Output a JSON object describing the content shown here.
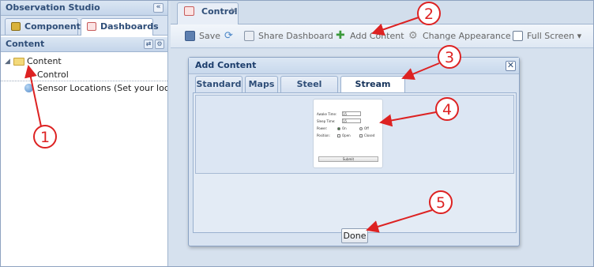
{
  "left_panel": {
    "title": "Observation Studio",
    "collapse_glyph": "«",
    "tabs": [
      {
        "label": "Components",
        "icon": "components-icon",
        "active": false
      },
      {
        "label": "Dashboards",
        "icon": "dashboards-icon",
        "active": true
      }
    ],
    "content_header": "Content",
    "tree": [
      {
        "label": "Content",
        "icon": "folder-icon",
        "expander": "◢"
      },
      {
        "label": "Control"
      },
      {
        "label": "Sensor Locations (Set your location by",
        "icon": "globe-icon"
      }
    ]
  },
  "doc_tab": {
    "label": "Control",
    "close": "✕"
  },
  "toolbar": {
    "save": "Save",
    "refresh_icon": "refresh-icon",
    "share_dashboard": "Share Dashboard",
    "add_content": "Add Content",
    "change_appearance": "Change Appearance",
    "full_screen": "Full Screen",
    "full_screen_caret": "▾"
  },
  "dialog": {
    "title": "Add Content",
    "close_glyph": "✕",
    "tabs": [
      "Standard",
      "Maps",
      "Steel Series",
      "Stream Forms"
    ],
    "active_tab": "Stream Forms",
    "form_thumbnail": {
      "fields": [
        {
          "label": "Awake Time:",
          "value": "15"
        },
        {
          "label": "Sleep Time:",
          "value": "15"
        }
      ],
      "power_label": "Power:",
      "power_options": [
        "On",
        "Off"
      ],
      "position_label": "Position:",
      "position_options": [
        "Open",
        "Closed"
      ],
      "submit": "Submit"
    },
    "done_label": "Done"
  },
  "annotations": [
    "1",
    "2",
    "3",
    "4",
    "5"
  ],
  "colors": {
    "annotation": "#dd2222",
    "accent": "#2f4e78"
  }
}
